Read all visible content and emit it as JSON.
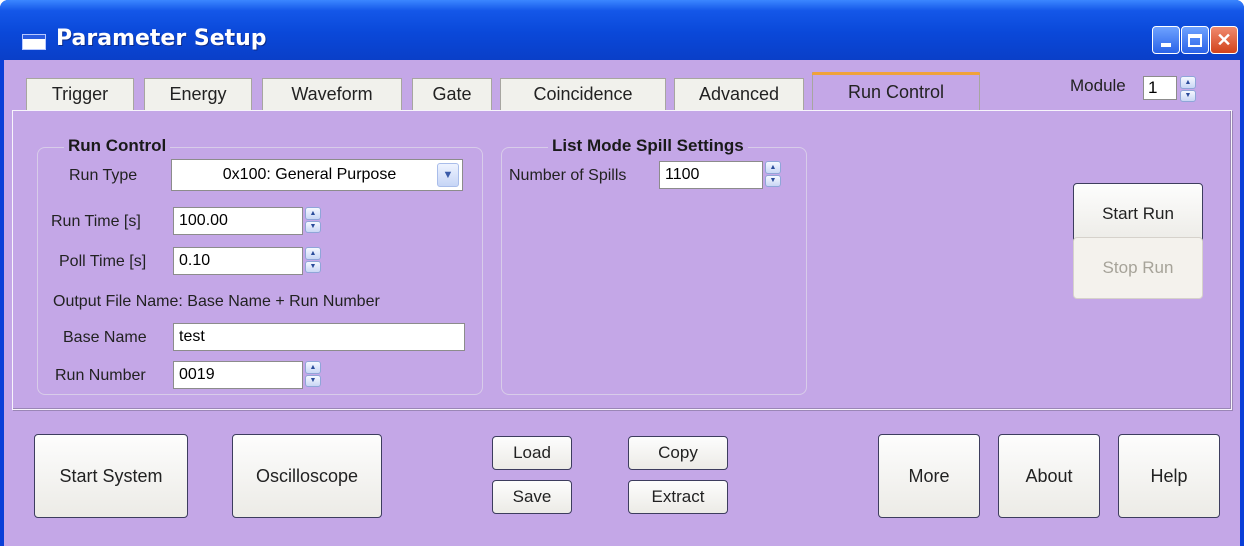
{
  "window": {
    "title": "Parameter Setup"
  },
  "tabs": [
    {
      "label": "Trigger"
    },
    {
      "label": "Energy"
    },
    {
      "label": "Waveform"
    },
    {
      "label": "Gate"
    },
    {
      "label": "Coincidence"
    },
    {
      "label": "Advanced"
    },
    {
      "label": "Run Control",
      "active": true
    }
  ],
  "module": {
    "label": "Module",
    "value": "1"
  },
  "run_control": {
    "title": "Run Control",
    "run_type_label": "Run Type",
    "run_type_value": "0x100: General Purpose",
    "run_time_label": "Run Time [s]",
    "run_time_value": "100.00",
    "poll_time_label": "Poll Time [s]",
    "poll_time_value": "0.10",
    "output_note": "Output File Name: Base Name + Run Number",
    "base_name_label": "Base Name",
    "base_name_value": "test",
    "run_number_label": "Run Number",
    "run_number_value": "0019"
  },
  "spill": {
    "title": "List Mode Spill Settings",
    "spills_label": "Number of Spills",
    "spills_value": "1100"
  },
  "run_buttons": {
    "start": "Start Run",
    "stop": "Stop Run"
  },
  "bottom_buttons": {
    "start_system": "Start System",
    "oscilloscope": "Oscilloscope",
    "load": "Load",
    "save": "Save",
    "copy": "Copy",
    "extract": "Extract",
    "more": "More",
    "about": "About",
    "help": "Help"
  }
}
